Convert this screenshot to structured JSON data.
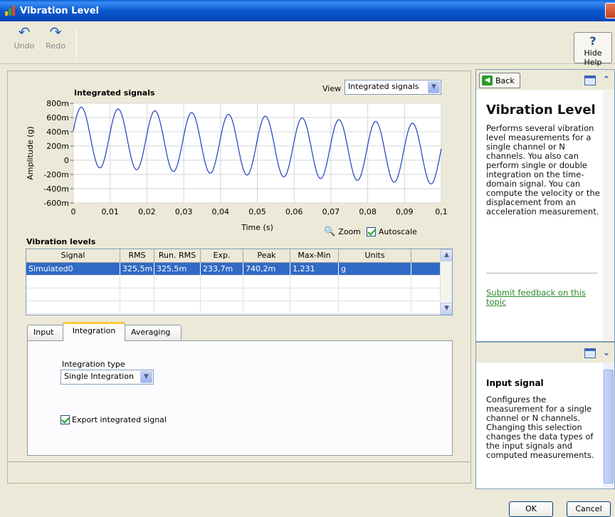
{
  "window": {
    "title": "Vibration Level"
  },
  "toolbar": {
    "undo_label": "Undo",
    "redo_label": "Redo",
    "hide_help_label": "Hide Help"
  },
  "graph": {
    "title": "Integrated signals",
    "view_label": "View",
    "view_value": "Integrated signals",
    "zoom_label": "Zoom",
    "autoscale_label": "Autoscale",
    "autoscale_checked": true
  },
  "chart_data": {
    "type": "line",
    "title": "Integrated signals",
    "xlabel": "Time (s)",
    "ylabel": "Amplitude (g)",
    "xlim": [
      0,
      0.1
    ],
    "ylim": [
      -0.6,
      0.8
    ],
    "x_tick_labels": [
      "0",
      "0,01",
      "0,02",
      "0,03",
      "0,04",
      "0,05",
      "0,06",
      "0,07",
      "0,08",
      "0,09",
      "0,1"
    ],
    "y_tick_labels": [
      "800m",
      "600m",
      "400m",
      "200m",
      "0",
      "-200m",
      "-400m",
      "-600m"
    ],
    "grid": true,
    "series": [
      {
        "frequency_hz": 100,
        "mean_start": 0.33,
        "mean_end": 0.08,
        "amplitude": 0.42,
        "color": "#1f3fbf"
      }
    ]
  },
  "vibration": {
    "title": "Vibration levels",
    "columns": [
      "Signal",
      "RMS",
      "Run. RMS",
      "Exp.",
      "Peak",
      "Max-Min",
      "Units"
    ],
    "rows": [
      [
        "Simulated0",
        "325,5m",
        "325,5m",
        "233,7m",
        "740,2m",
        "1,231",
        "g"
      ]
    ]
  },
  "tabs": [
    {
      "label": "Input"
    },
    {
      "label": "Integration",
      "active": true
    },
    {
      "label": "Averaging"
    }
  ],
  "integration": {
    "type_label": "Integration type",
    "type_value": "Single Integration",
    "export_label": "Export integrated signal",
    "export_checked": true
  },
  "help": {
    "back_label": "Back",
    "title": "Vibration Level",
    "body": "Performs several vibration level measurements for a single channel or N channels. You also can perform single or double integration on the time-domain signal. You can compute the velocity or the displacement from an acceleration measurement.",
    "feedback_link": "Submit feedback on this topic",
    "context_title": "Input signal",
    "context_body": "Configures the measurement for a single channel or N channels. Changing this selection changes the data types of the input signals and computed measurements."
  },
  "buttons": {
    "ok": "OK",
    "cancel": "Cancel"
  }
}
